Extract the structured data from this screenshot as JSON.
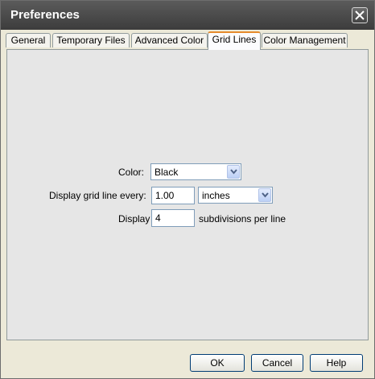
{
  "window": {
    "title": "Preferences"
  },
  "tabs": [
    {
      "label": "General"
    },
    {
      "label": "Temporary Files"
    },
    {
      "label": "Advanced Color"
    },
    {
      "label": "Grid Lines",
      "active": true
    },
    {
      "label": "Color Management"
    }
  ],
  "grid": {
    "color_label": "Color:",
    "color_value": "Black",
    "spacing_label": "Display grid line every:",
    "spacing_value": "1.00",
    "unit_value": "inches",
    "subdiv_label": "Display",
    "subdiv_value": "4",
    "subdiv_suffix": "subdivisions per line"
  },
  "buttons": {
    "ok": "OK",
    "cancel": "Cancel",
    "help": "Help"
  },
  "icons": {
    "close": "close-icon",
    "dropdown": "chevron-down-icon"
  },
  "colors": {
    "titlebar": "#4a4a4a",
    "active_tab_accent": "#e68b2c",
    "panel": "#e6e6e6"
  }
}
